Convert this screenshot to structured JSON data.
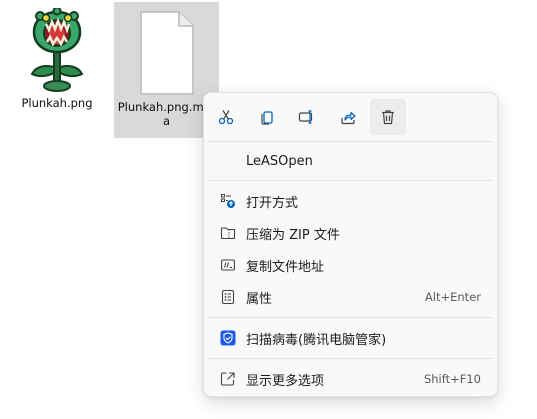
{
  "files": [
    {
      "name": "Plunkah.png",
      "thumbnail": "plant-monster-image",
      "selected": false
    },
    {
      "name": "Plunkah.png.meta",
      "thumbnail": "blank-document-icon",
      "selected": true
    }
  ],
  "context_menu": {
    "quick_actions": [
      {
        "name": "cut",
        "icon": "scissors-icon"
      },
      {
        "name": "copy",
        "icon": "copy-icon"
      },
      {
        "name": "rename",
        "icon": "rename-icon"
      },
      {
        "name": "share",
        "icon": "share-icon"
      },
      {
        "name": "delete",
        "icon": "trash-icon",
        "highlighted": true
      }
    ],
    "items": [
      {
        "label": "LeASOpen",
        "icon": "",
        "shortcut": ""
      },
      {
        "label": "打开方式",
        "icon": "open-with-icon",
        "shortcut": ""
      },
      {
        "label": "压缩为 ZIP 文件",
        "icon": "zip-folder-icon",
        "shortcut": ""
      },
      {
        "label": "复制文件地址",
        "icon": "copy-path-icon",
        "shortcut": ""
      },
      {
        "label": "属性",
        "icon": "properties-icon",
        "shortcut": "Alt+Enter"
      },
      {
        "label": "扫描病毒(腾讯电脑管家)",
        "icon": "shield-check-icon",
        "shortcut": ""
      },
      {
        "label": "显示更多选项",
        "icon": "show-more-icon",
        "shortcut": "Shift+F10"
      }
    ]
  },
  "colors": {
    "accent": "#0067c0",
    "shield": "#1e5ae6",
    "selection": "#d9d9d9",
    "menu_bg": "#f9f9f9"
  }
}
